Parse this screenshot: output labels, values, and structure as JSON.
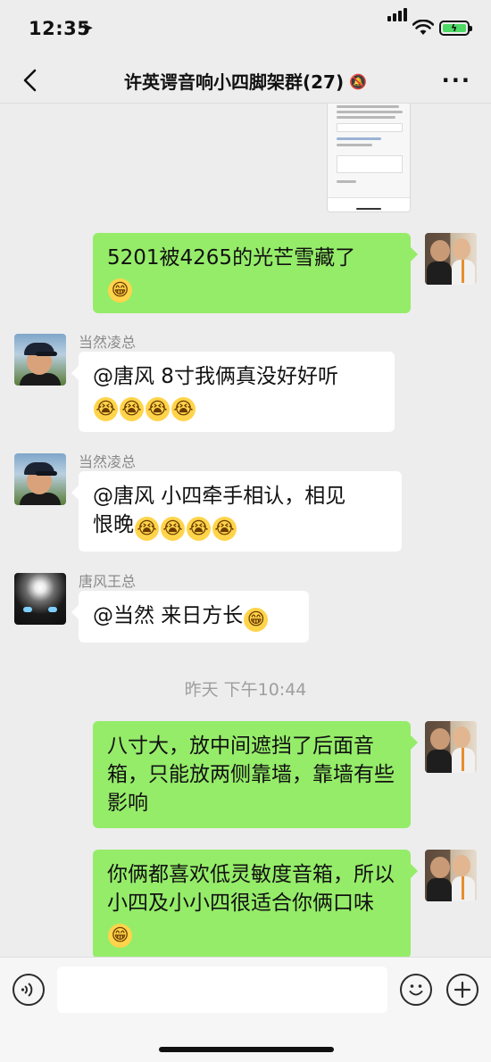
{
  "status": {
    "time": "12:35"
  },
  "nav": {
    "title": "许英谔音响小四脚架群(27)"
  },
  "messages": [
    {
      "side": "out",
      "text": "5201被4265的光芒雪藏了",
      "emoji": [
        "😁"
      ]
    },
    {
      "side": "in",
      "sender": "当然凌总",
      "text": "@唐风 8寸我俩真没好好听",
      "emoji": [
        "😭",
        "😭",
        "😭",
        "😭"
      ]
    },
    {
      "side": "in",
      "sender": "当然凌总",
      "text_line1": "@唐风 小四牵手相认，相见",
      "text_line2": "恨晚",
      "emoji": [
        "😭",
        "😭",
        "😭",
        "😭"
      ]
    },
    {
      "side": "in",
      "sender": "唐风王总",
      "text": "@当然 来日方长",
      "emoji": [
        "😁"
      ]
    },
    {
      "side": "out",
      "text": "八寸大，放中间遮挡了后面音箱，只能放两侧靠墙，靠墙有些影响"
    },
    {
      "side": "out",
      "text": "你俩都喜欢低灵敏度音箱，所以小四及小小四很适合你俩口味",
      "emoji": [
        "😁"
      ]
    }
  ],
  "timestamp": "昨天 下午10:44",
  "input": {
    "value": ""
  }
}
